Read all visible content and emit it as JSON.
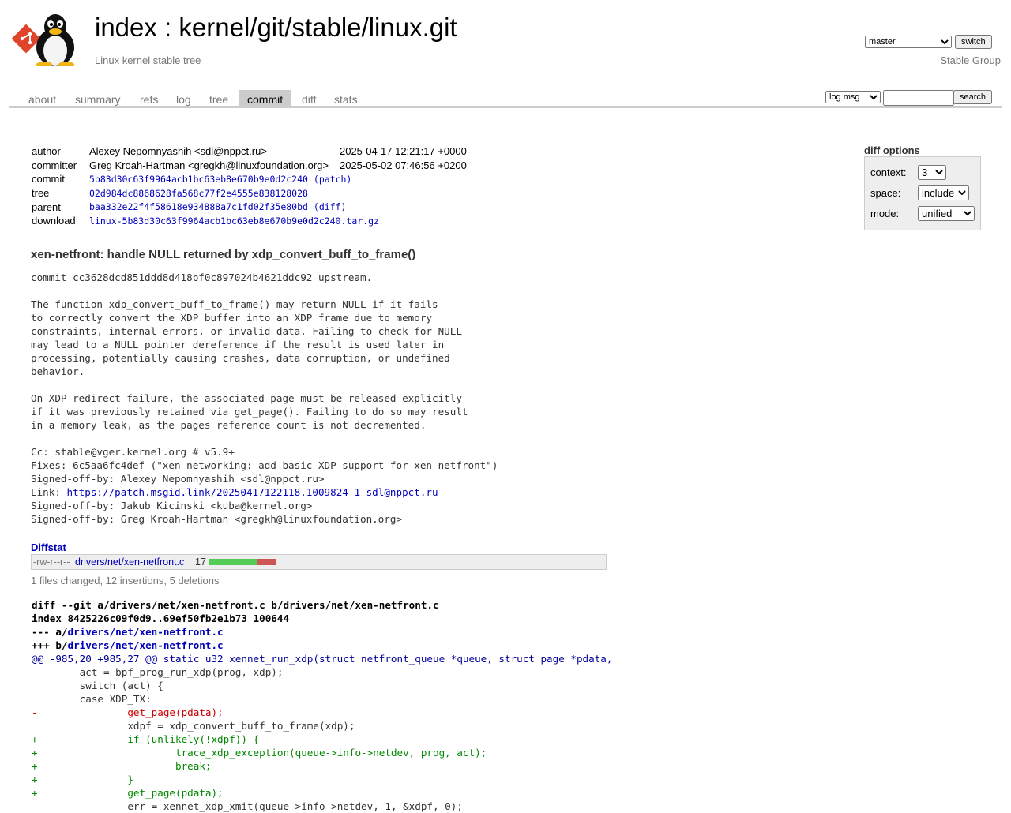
{
  "header": {
    "title_index": "index",
    "title_sep": " : ",
    "title_repo": "kernel/git/stable/linux.git",
    "subtitle": "Linux kernel stable tree",
    "owner": "Stable Group",
    "branch_selected": "master",
    "switch_label": "switch"
  },
  "tabs": [
    {
      "label": "about",
      "active": false
    },
    {
      "label": "summary",
      "active": false
    },
    {
      "label": "refs",
      "active": false
    },
    {
      "label": "log",
      "active": false
    },
    {
      "label": "tree",
      "active": false
    },
    {
      "label": "commit",
      "active": true
    },
    {
      "label": "diff",
      "active": false
    },
    {
      "label": "stats",
      "active": false
    }
  ],
  "search": {
    "kind_selected": "log msg",
    "query": "",
    "button_label": "search"
  },
  "diff_options": {
    "title": "diff options",
    "context_label": "context:",
    "context_value": "3",
    "space_label": "space:",
    "space_value": "include",
    "mode_label": "mode:",
    "mode_value": "unified"
  },
  "commit_info": {
    "author_key": "author",
    "author": "Alexey Nepomnyashih <sdl@nppct.ru>",
    "author_date": "2025-04-17 12:21:17 +0000",
    "committer_key": "committer",
    "committer": "Greg Kroah-Hartman <gregkh@linuxfoundation.org>",
    "committer_date": "2025-05-02 07:46:56 +0200",
    "commit_key": "commit",
    "commit": "5b83d30c63f9964acb1bc63eb8e670b9e0d2c240",
    "commit_patch": "(patch)",
    "tree_key": "tree",
    "tree": "02d984dc8868628fa568c77f2e4555e838128028",
    "parent_key": "parent",
    "parent": "baa332e22f4f58618e934888a7c1fd02f35e80bd",
    "parent_diff": "(diff)",
    "download_key": "download",
    "download": "linux-5b83d30c63f9964acb1bc63eb8e670b9e0d2c240.tar.gz"
  },
  "subject": "xen-netfront: handle NULL returned by xdp_convert_buff_to_frame()",
  "message": {
    "before_link": "commit cc3628dcd851ddd8d418bf0c897024b4621ddc92 upstream.\n\nThe function xdp_convert_buff_to_frame() may return NULL if it fails\nto correctly convert the XDP buffer into an XDP frame due to memory\nconstraints, internal errors, or invalid data. Failing to check for NULL\nmay lead to a NULL pointer dereference if the result is used later in\nprocessing, potentially causing crashes, data corruption, or undefined\nbehavior.\n\nOn XDP redirect failure, the associated page must be released explicitly\nif it was previously retained via get_page(). Failing to do so may result\nin a memory leak, as the pages reference count is not decremented.\n\nCc: stable@vger.kernel.org # v5.9+\nFixes: 6c5aa6fc4def (\"xen networking: add basic XDP support for xen-netfront\")\nSigned-off-by: Alexey Nepomnyashih <sdl@nppct.ru>\nLink: ",
    "link": "https://patch.msgid.link/20250417122118.1009824-1-sdl@nppct.ru",
    "after_link": "\nSigned-off-by: Jakub Kicinski <kuba@kernel.org>\nSigned-off-by: Greg Kroah-Hartman <gregkh@linuxfoundation.org>"
  },
  "diffstat": {
    "header": "Diffstat",
    "mode": "-rw-r--r--",
    "file": "drivers/net/xen-netfront.c",
    "count": "17",
    "insertions": 12,
    "deletions": 5,
    "summary": "1 files changed, 12 insertions, 5 deletions",
    "add_color": "#55cc55",
    "del_color": "#cc5555"
  },
  "diff": {
    "git_line": "diff --git a/drivers/net/xen-netfront.c b/drivers/net/xen-netfront.c",
    "index_line": "index 8425226c09f0d9..69ef50fb2e1b73 100644",
    "minus_prefix": "--- a/",
    "minus_file": "drivers/net/xen-netfront.c",
    "plus_prefix": "+++ b/",
    "plus_file": "drivers/net/xen-netfront.c",
    "lines": [
      {
        "type": "hunk",
        "text": "@@ -985,20 +985,27 @@ static u32 xennet_run_xdp(struct netfront_queue *queue, struct page *pdata,"
      },
      {
        "type": "ctx",
        "text": " \tact = bpf_prog_run_xdp(prog, xdp);"
      },
      {
        "type": "ctx",
        "text": " \tswitch (act) {"
      },
      {
        "type": "ctx",
        "text": " \tcase XDP_TX:"
      },
      {
        "type": "del",
        "text": "-\t\tget_page(pdata);"
      },
      {
        "type": "ctx",
        "text": " \t\txdpf = xdp_convert_buff_to_frame(xdp);"
      },
      {
        "type": "add",
        "text": "+\t\tif (unlikely(!xdpf)) {"
      },
      {
        "type": "add",
        "text": "+\t\t\ttrace_xdp_exception(queue->info->netdev, prog, act);"
      },
      {
        "type": "add",
        "text": "+\t\t\tbreak;"
      },
      {
        "type": "add",
        "text": "+\t\t}"
      },
      {
        "type": "add",
        "text": "+\t\tget_page(pdata);"
      },
      {
        "type": "ctx",
        "text": " \t\terr = xennet_xdp_xmit(queue->info->netdev, 1, &xdpf, 0);"
      }
    ]
  }
}
